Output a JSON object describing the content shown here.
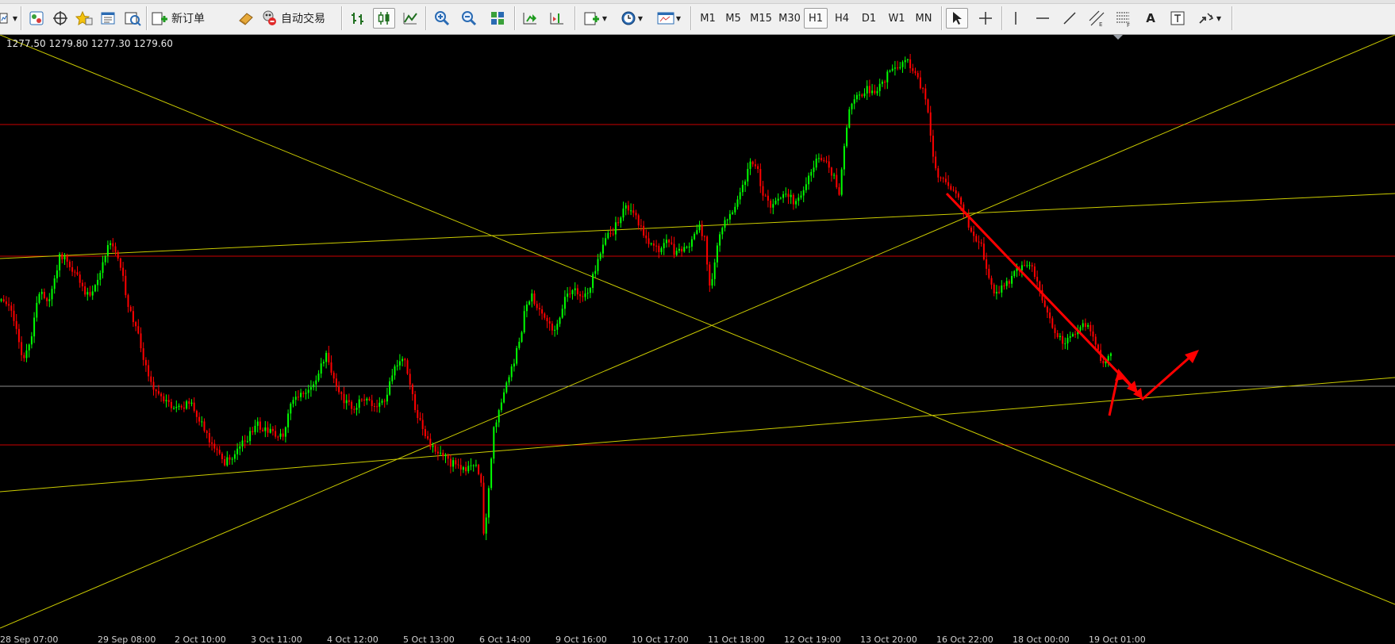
{
  "toolbar": {
    "new_order_label": "新订单",
    "auto_trading_label": "自动交易",
    "timeframes": [
      "M1",
      "M5",
      "M15",
      "M30",
      "H1",
      "H4",
      "D1",
      "W1",
      "MN"
    ],
    "active_timeframe": "H1",
    "text_tool_label": "A",
    "icons": [
      "new-chart-icon",
      "market-watch-icon",
      "navigator-icon",
      "favorites-icon",
      "terminal-icon",
      "strategy-tester-icon",
      "new-order-icon",
      "auto-trading-icon",
      "bar-chart-icon",
      "candlestick-icon",
      "line-chart-icon",
      "zoom-in-icon",
      "zoom-out-icon",
      "tile-windows-icon",
      "autoscroll-icon",
      "chart-shift-icon",
      "indicators-icon",
      "periods-icon",
      "templates-icon",
      "cursor-icon",
      "crosshair-icon",
      "vertical-line-icon",
      "horizontal-line-icon",
      "trendline-icon",
      "equidistant-channel-icon",
      "fibonacci-icon",
      "text-label-icon",
      "arrows-icon"
    ]
  },
  "chart": {
    "ohlc_readout": "1277.50 1279.80 1277.30 1279.60",
    "time_labels": [
      "28 Sep 07:00",
      "29 Sep 08:00",
      "2 Oct 10:00",
      "3 Oct 11:00",
      "4 Oct 12:00",
      "5 Oct 13:00",
      "6 Oct 14:00",
      "9 Oct 16:00",
      "10 Oct 17:00",
      "11 Oct 18:00",
      "12 Oct 19:00",
      "13 Oct 20:00",
      "16 Oct 22:00",
      "18 Oct 00:00",
      "19 Oct 01:00"
    ],
    "colors": {
      "background": "#000000",
      "bull_candle": "#00ff00",
      "bear_candle": "#ff0000",
      "horizontal_lines": "#cc0000",
      "trendlines": "#cccc00",
      "projection_arrows": "#ff0000",
      "bid_line": "#8c8c8c"
    }
  }
}
